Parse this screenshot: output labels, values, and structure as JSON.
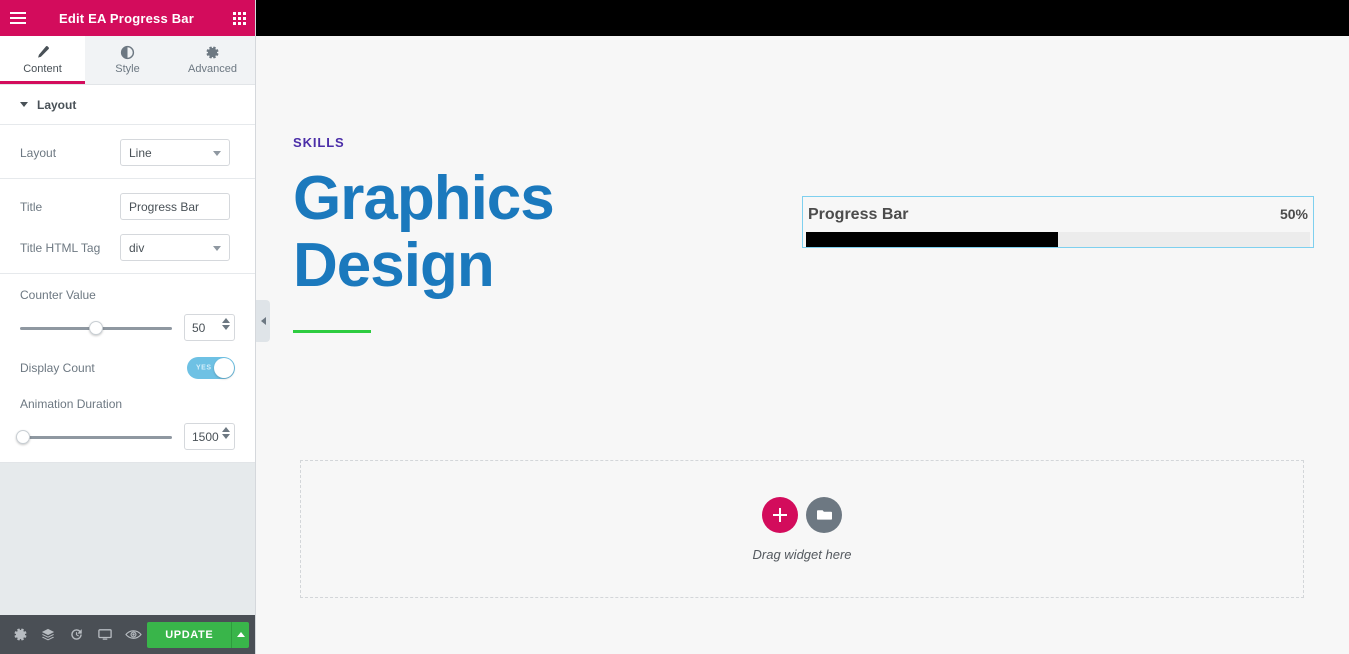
{
  "panel": {
    "header": {
      "title": "Edit EA Progress Bar",
      "menu_icon": "hamburger-menu-icon",
      "grid_icon": "apps-grid-icon",
      "bg_color": "#d30c5c"
    },
    "tabs": [
      {
        "label": "Content",
        "icon": "pencil-icon",
        "active": true
      },
      {
        "label": "Style",
        "icon": "contrast-circle-icon",
        "active": false
      },
      {
        "label": "Advanced",
        "icon": "gear-icon",
        "active": false
      }
    ],
    "section": {
      "title": "Layout",
      "caret_icon": "chevron-down-icon"
    },
    "controls": {
      "layout_label": "Layout",
      "layout_value": "Line",
      "title_label": "Title",
      "title_value": "Progress Bar",
      "title_placeholder": "Progress Bar",
      "title_html_tag_label": "Title HTML Tag",
      "title_html_tag_value": "div",
      "counter_value_label": "Counter Value",
      "counter_value": "50",
      "counter_slider_percent": 50,
      "display_count_label": "Display Count",
      "display_count_state": "YES",
      "animation_duration_label": "Animation Duration",
      "animation_duration_value": "1500",
      "animation_slider_percent": 2
    },
    "footer": {
      "icons": [
        "settings-gear-icon",
        "navigator-layers-icon",
        "history-revisions-icon",
        "responsive-mode-icon",
        "preview-eye-icon"
      ],
      "update_label": "UPDATE",
      "update_color": "#39b54a",
      "caret_icon": "chevron-up-icon"
    }
  },
  "canvas": {
    "collapse_handle_icon": "chevron-left-icon",
    "hero": {
      "eyebrow": "SKILLS",
      "title_line1": "Graphics",
      "title_line2": "Design",
      "eyebrow_color": "#4b2ea8",
      "title_color": "#1b79bd",
      "rule_color": "#2ecc40"
    },
    "progress_widget": {
      "title": "Progress Bar",
      "percent_label": "50%",
      "percent_value": 50,
      "fill_color": "#000000",
      "track_color": "#ececec",
      "selection_border_color": "#7ed0ef"
    },
    "dropzone": {
      "add_icon": "plus-circle-icon",
      "folder_icon": "folder-template-icon",
      "hint": "Drag widget here"
    }
  }
}
